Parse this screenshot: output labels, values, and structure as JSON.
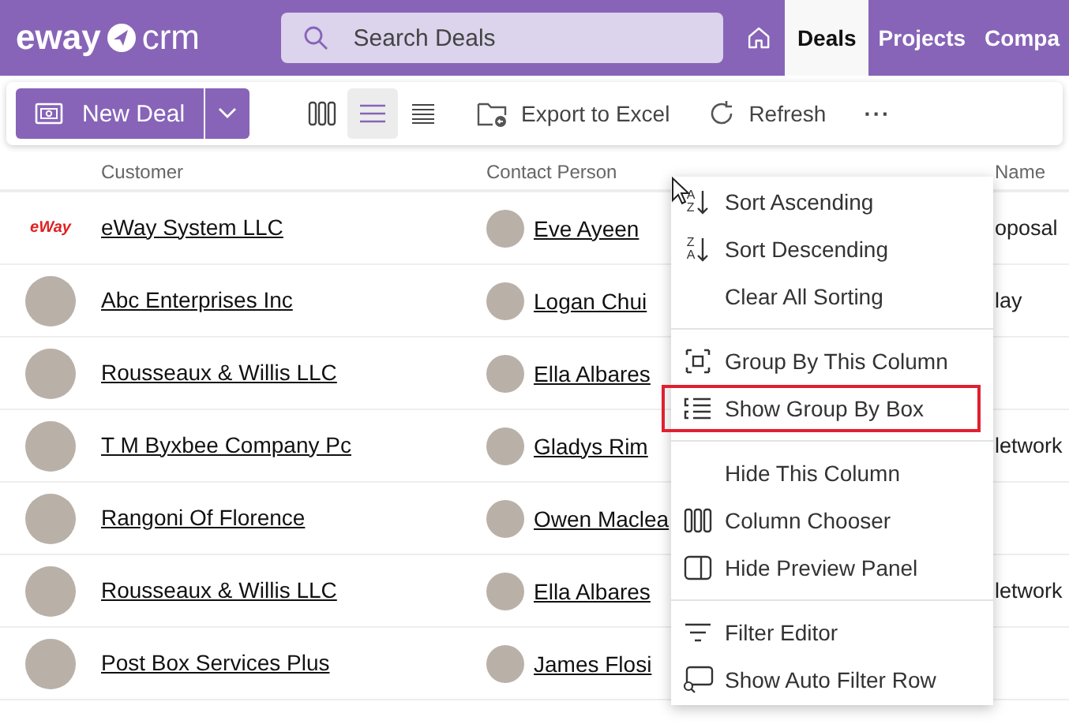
{
  "header": {
    "logo": "eway",
    "logo_suffix": "crm",
    "search": {
      "placeholder": "Search Deals"
    },
    "tabs": [
      {
        "label": "Deals",
        "selected": true
      },
      {
        "label": "Projects",
        "selected": false
      },
      {
        "label": "Compa",
        "selected": false
      }
    ]
  },
  "toolbar": {
    "new_button": "New Deal",
    "views": [
      {
        "kind": "columns",
        "selected": false
      },
      {
        "kind": "list",
        "selected": true
      },
      {
        "kind": "compact",
        "selected": false
      }
    ],
    "actions": [
      {
        "kind": "export",
        "label": "Export to Excel"
      },
      {
        "kind": "refresh",
        "label": "Refresh"
      },
      {
        "kind": "more",
        "label": "···"
      }
    ]
  },
  "table": {
    "columns": [
      "Customer",
      "Contact Person",
      "Name"
    ],
    "rows": [
      {
        "customer": "eWay System LLC",
        "logo_text": "eWay",
        "contact": "Eve Ayeen",
        "name": "oposal"
      },
      {
        "customer": "Abc Enterprises Inc",
        "contact": "Logan Chui",
        "name": "lay"
      },
      {
        "customer": "Rousseaux & Willis LLC",
        "contact": "Ella Albares",
        "name": ""
      },
      {
        "customer": "T M Byxbee Company Pc",
        "contact": "Gladys Rim",
        "name": "letwork"
      },
      {
        "customer": "Rangoni Of Florence",
        "contact": "Owen Maclea",
        "name": ""
      },
      {
        "customer": "Rousseaux & Willis LLC",
        "contact": "Ella Albares",
        "name": "letwork"
      },
      {
        "customer": "Post Box Services Plus",
        "contact": "James Flosi",
        "name": ""
      }
    ]
  },
  "context_menu": {
    "items": [
      {
        "kind": "sort",
        "icon_letters": [
          "A",
          "Z"
        ],
        "label": "Sort Ascending",
        "highlighted": false
      },
      {
        "kind": "sort",
        "icon_letters": [
          "Z",
          "A"
        ],
        "label": "Sort Descending",
        "highlighted": false
      },
      {
        "kind": "plain",
        "label": "Clear All Sorting",
        "highlighted": false
      },
      {
        "kind": "separator"
      },
      {
        "kind": "group",
        "label": "Group By This Column",
        "highlighted": false
      },
      {
        "kind": "groupbox",
        "label": "Show Group By Box",
        "highlighted": true
      },
      {
        "kind": "separator"
      },
      {
        "kind": "plain",
        "label": "Hide This Column",
        "highlighted": false
      },
      {
        "kind": "columns",
        "label": "Column Chooser",
        "highlighted": false
      },
      {
        "kind": "panel",
        "label": "Hide Preview Panel",
        "highlighted": false
      },
      {
        "kind": "separator"
      },
      {
        "kind": "filter",
        "label": "Filter Editor",
        "highlighted": false
      },
      {
        "kind": "autofilter",
        "label": "Show Auto Filter Row",
        "highlighted": false
      }
    ]
  }
}
